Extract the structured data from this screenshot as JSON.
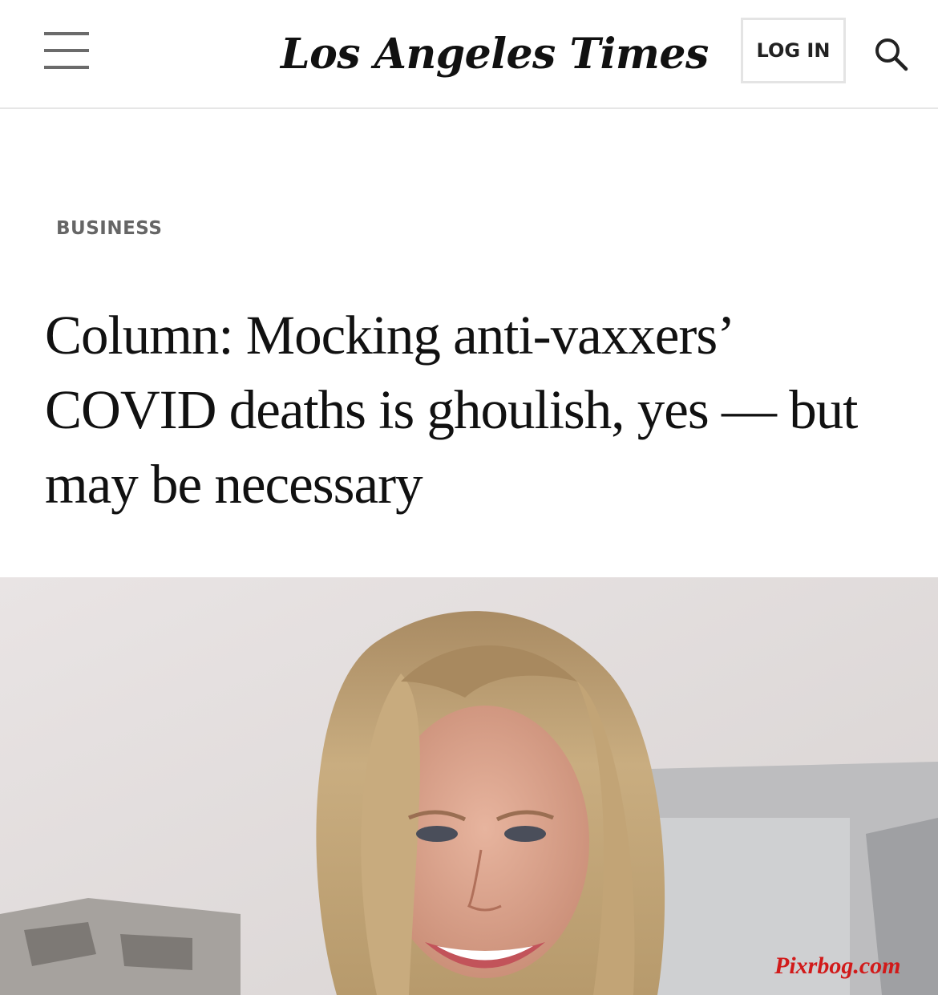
{
  "header": {
    "logo": "Los Angeles Times",
    "login_label": "LOG IN",
    "menu_icon": "hamburger-menu-icon",
    "search_icon": "search-icon"
  },
  "article": {
    "section": "BUSINESS",
    "headline": "Column: Mocking anti-vaxxers’ COVID deaths is ghoulish, yes — but may be necessary"
  },
  "watermark": "Pixrbog.com",
  "colors": {
    "text": "#111111",
    "section_label": "#666666",
    "watermark": "#d11a1a",
    "divider": "#e6e6e6"
  }
}
